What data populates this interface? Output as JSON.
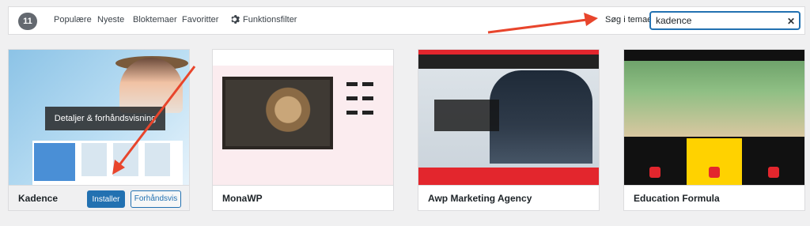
{
  "filter_bar": {
    "count": "11",
    "nav": [
      "Populære",
      "Nyeste",
      "Bloktemaer",
      "Favoritter"
    ],
    "feature_filter": "Funktionsfilter",
    "search_label": "Søg i temaer",
    "search_value": "kadence"
  },
  "themes": [
    {
      "name": "Kadence",
      "hover_overlay": "Detaljer & forhåndsvisning",
      "install_label": "Installer",
      "preview_label": "Forhåndsvis"
    },
    {
      "name": "MonaWP"
    },
    {
      "name": "Awp Marketing Agency"
    },
    {
      "name": "Education Formula"
    }
  ],
  "colors": {
    "primary": "#2271b1",
    "annotation_arrow": "#e8452c"
  }
}
